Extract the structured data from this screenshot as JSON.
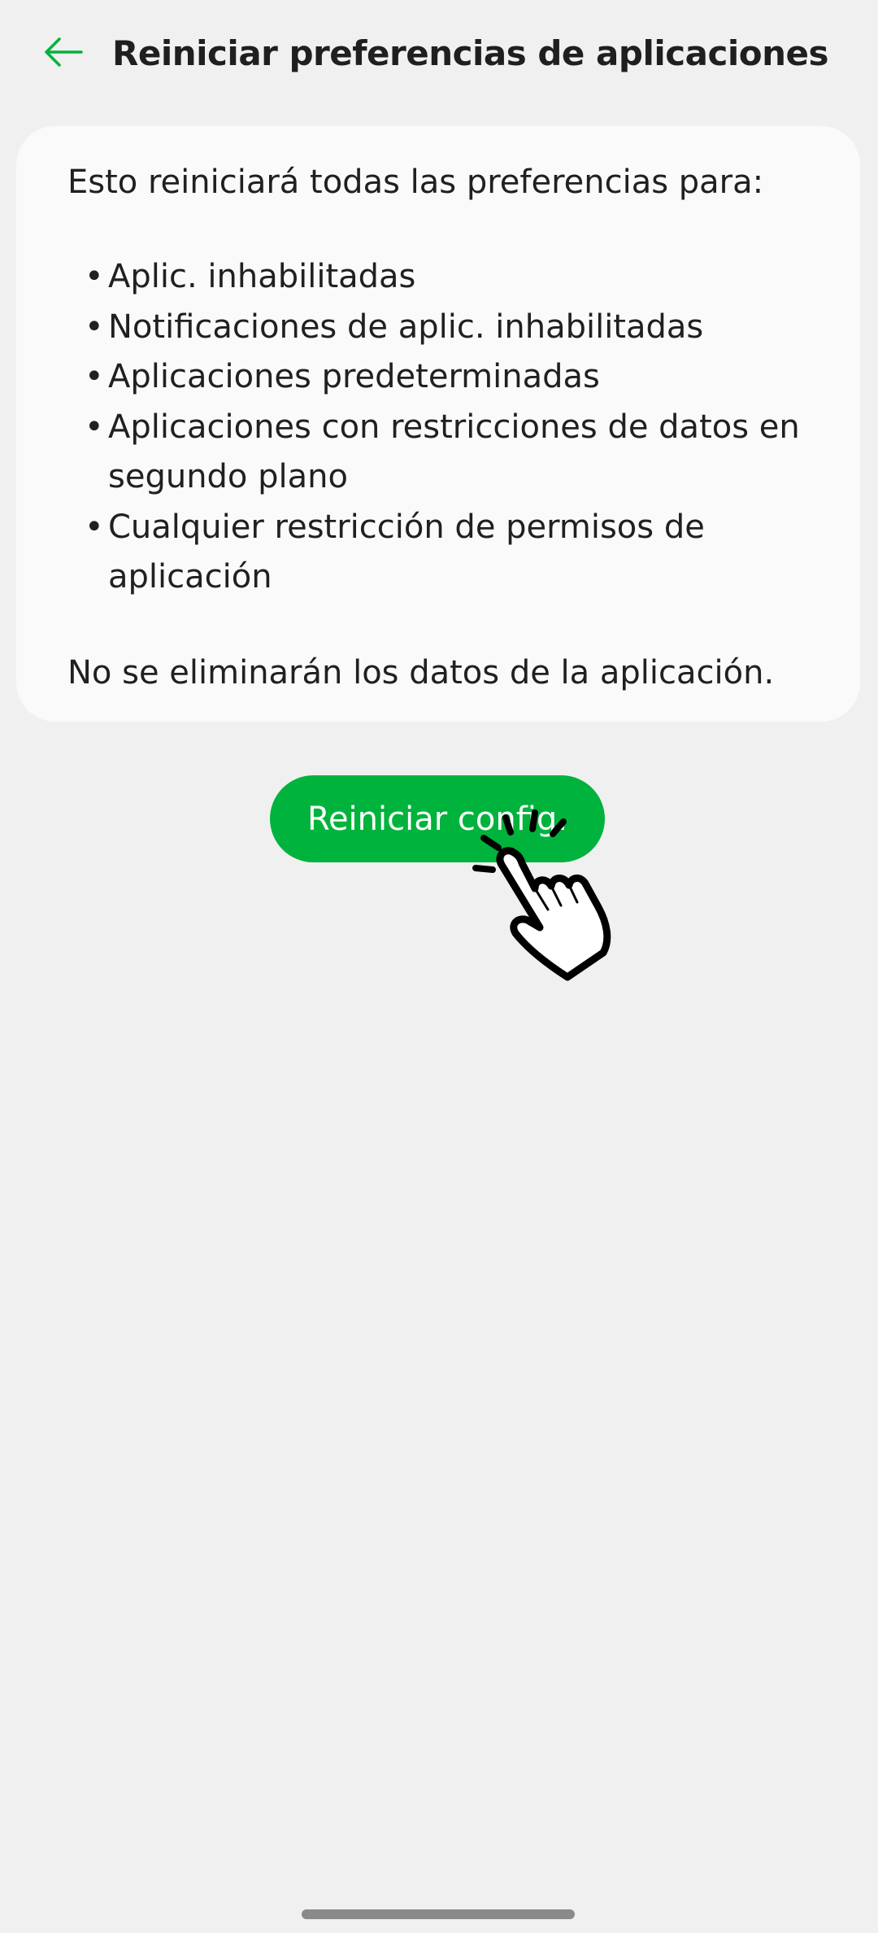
{
  "app_bar": {
    "title": "Reiniciar preferencias de aplicaciones",
    "back_icon": "arrow-left-icon"
  },
  "card": {
    "intro": "Esto reiniciará todas las preferencias para:",
    "bullet": "•",
    "items": [
      "Aplic. inhabilitadas",
      "Notificaciones de aplic. inhabilitadas",
      "Aplicaciones predeterminadas",
      "Aplicaciones con restricciones de datos en segundo plano",
      "Cualquier restricción de permisos de aplicación"
    ],
    "footer": "No se eliminarán los datos de la aplicación."
  },
  "reset_button": {
    "label": "Reiniciar config."
  },
  "overlay": {
    "icon": "pointing-hand-tap-icon"
  },
  "colors": {
    "accent": "#00b33c",
    "background": "#f0f0f0",
    "card": "#fafafa",
    "text": "#202020"
  }
}
